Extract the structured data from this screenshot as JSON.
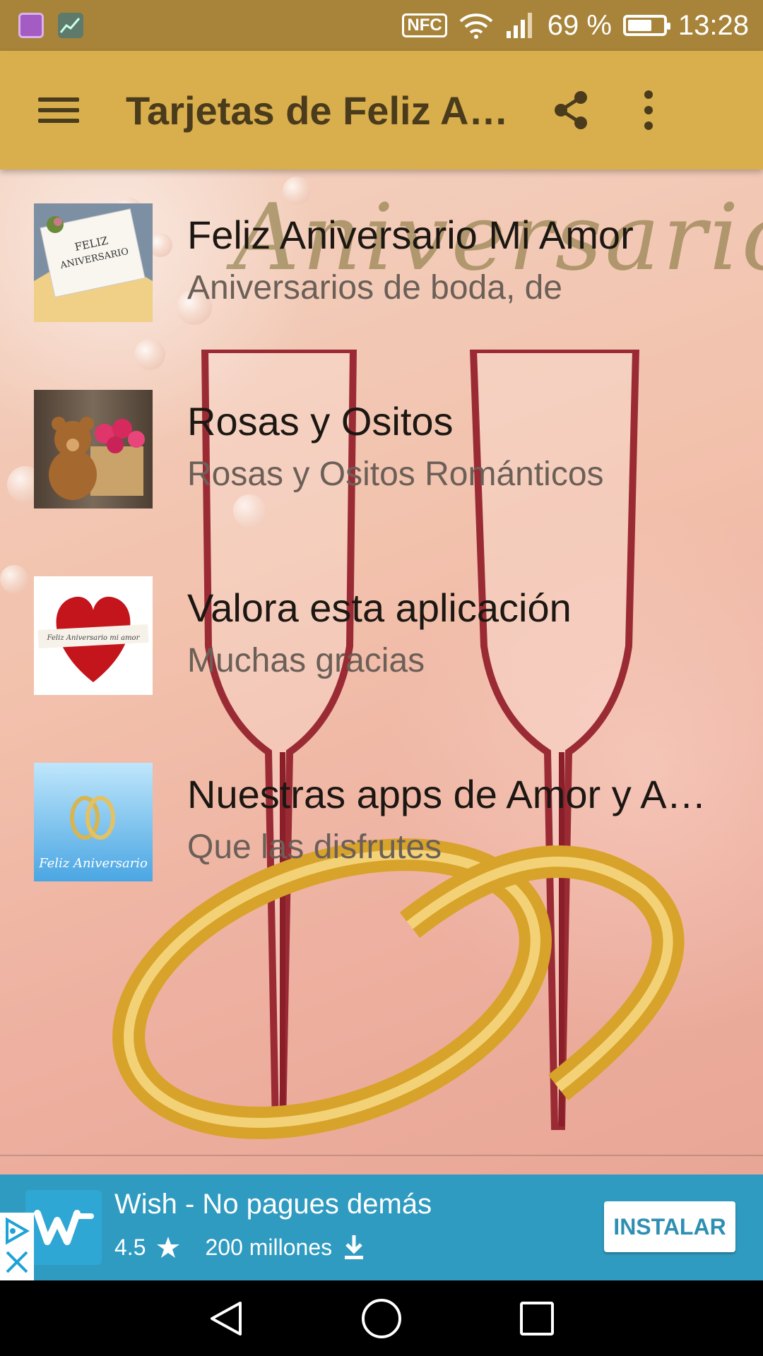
{
  "status_bar": {
    "nfc": "NFC",
    "battery_percent": "69 %",
    "battery_level": 0.69,
    "time": "13:28"
  },
  "toolbar": {
    "title": "Tarjetas de Feliz Aniversario",
    "background": "#d9ae4c"
  },
  "content": {
    "background_word": "Aniversario",
    "items": [
      {
        "title": "Feliz Aniversario Mi Amor",
        "subtitle": "Aniversarios de boda, de",
        "thumb_text": "FELIZ ANIVERSARIO"
      },
      {
        "title": "Rosas y Ositos",
        "subtitle": "Rosas y Ositos Románticos"
      },
      {
        "title": "Valora esta aplicación",
        "subtitle": "Muchas gracias",
        "thumb_text": "Feliz Aniversario mi amor"
      },
      {
        "title": "Nuestras apps de Amor y Amistad",
        "subtitle": "Que las disfrutes",
        "thumb_text": "Feliz Aniversario"
      }
    ]
  },
  "ad": {
    "title": "Wish - No pagues demás",
    "rating": "4.5",
    "installs": "200 millones",
    "button": "INSTALAR",
    "background": "#2f9bc1"
  },
  "icons": [
    "menu-icon",
    "share-icon",
    "more-vert-icon",
    "wifi-icon",
    "signal-icon",
    "battery-icon",
    "star-icon",
    "download-icon",
    "adchoices-icon",
    "close-icon",
    "back-icon",
    "home-icon",
    "recents-icon"
  ]
}
